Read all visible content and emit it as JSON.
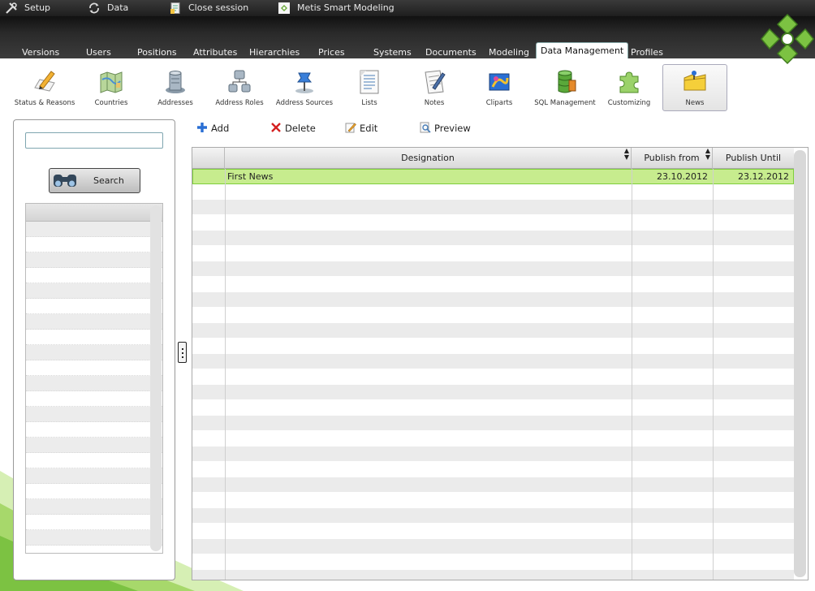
{
  "topbar": {
    "items": [
      {
        "label": "Setup",
        "icon": "tools-icon"
      },
      {
        "label": "Data",
        "icon": "refresh-icon"
      },
      {
        "label": "Close session",
        "icon": "document-icon"
      },
      {
        "label": "Metis Smart Modeling",
        "icon": "app-logo-icon"
      }
    ]
  },
  "tabs": [
    {
      "label": "Versions"
    },
    {
      "label": "Users"
    },
    {
      "label": "Positions"
    },
    {
      "label": "Attributes"
    },
    {
      "label": "Hierarchies"
    },
    {
      "label": "Prices"
    },
    {
      "label": "Systems"
    },
    {
      "label": "Documents"
    },
    {
      "label": "Modeling"
    },
    {
      "label": "Data Management",
      "active": true
    },
    {
      "label": "Profiles"
    }
  ],
  "toolbar": {
    "items": [
      {
        "label": "Status & Reasons",
        "icon": "pencil-paper-icon"
      },
      {
        "label": "Countries",
        "icon": "map-icon"
      },
      {
        "label": "Addresses",
        "icon": "server-icon"
      },
      {
        "label": "Address Roles",
        "icon": "network-icon"
      },
      {
        "label": "Address Sources",
        "icon": "pushpin-icon"
      },
      {
        "label": "Lists",
        "icon": "list-icon"
      },
      {
        "label": "Notes",
        "icon": "notes-icon"
      },
      {
        "label": "Cliparts",
        "icon": "clipart-icon"
      },
      {
        "label": "SQL Management",
        "icon": "database-icon"
      },
      {
        "label": "Customizing",
        "icon": "puzzle-icon"
      },
      {
        "label": "News",
        "icon": "news-folder-icon",
        "selected": true
      }
    ]
  },
  "left_panel": {
    "search_value": "",
    "search_button": "Search"
  },
  "actions": {
    "add": "Add",
    "delete": "Delete",
    "edit": "Edit",
    "preview": "Preview"
  },
  "grid": {
    "columns": [
      "",
      "Designation",
      "Publish from",
      "Publish Until"
    ],
    "rows": [
      {
        "designation": "First News",
        "publish_from": "23.10.2012",
        "publish_until": "23.12.2012",
        "selected": true
      }
    ]
  },
  "colors": {
    "selected_row": "#c7ec8e",
    "selected_border": "#7fcf3b",
    "dark_bar": "#1e1e1e",
    "brand_green": "#7cc242"
  }
}
